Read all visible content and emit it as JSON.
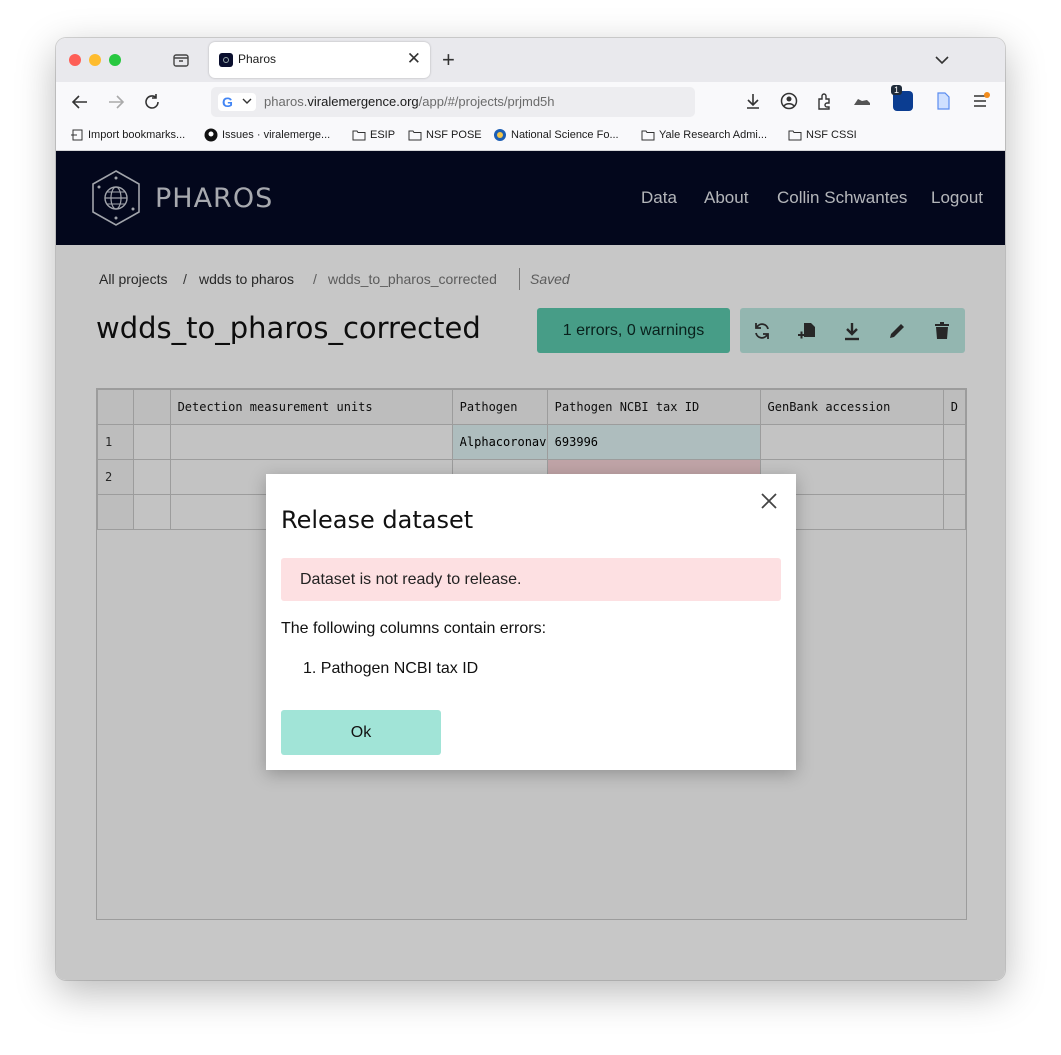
{
  "browser": {
    "tab_title": "Pharos",
    "url_prefix": "pharos.",
    "url_domain": "viralemergence.org",
    "url_path": "/app/#/projects/prjmd5h",
    "extension_badge": "1",
    "bookmarks": [
      {
        "label": "Import bookmarks...",
        "icon": "import-icon"
      },
      {
        "label": "Issues · viralemerge...",
        "icon": "github-icon"
      },
      {
        "label": "ESIP",
        "icon": "folder-icon"
      },
      {
        "label": "NSF POSE",
        "icon": "folder-icon"
      },
      {
        "label": "National Science Fo...",
        "icon": "nsf-icon"
      },
      {
        "label": "Yale Research Admi...",
        "icon": "folder-icon"
      },
      {
        "label": "NSF CSSI",
        "icon": "folder-icon"
      }
    ]
  },
  "site": {
    "logo_text": "PHAROS",
    "nav": [
      "Data",
      "About",
      "Collin Schwantes",
      "Logout"
    ]
  },
  "breadcrumb": {
    "items": [
      "All projects",
      "/",
      "wdds to pharos",
      "/",
      "wdds_to_pharos_corrected"
    ],
    "status": "Saved"
  },
  "dataset": {
    "title": "wdds_to_pharos_corrected",
    "status_button": "1 errors, 0 warnings",
    "actions": [
      "refresh-icon",
      "add-file-icon",
      "download-icon",
      "edit-icon",
      "trash-icon"
    ]
  },
  "grid": {
    "columns": [
      "",
      "",
      "Detection measurement units",
      "Pathogen",
      "Pathogen NCBI tax ID",
      "GenBank accession",
      "D"
    ],
    "rows": [
      [
        "1",
        "",
        "",
        "Alphacoronavi",
        "693996",
        "",
        ""
      ],
      [
        "2",
        "",
        "",
        "",
        "",
        "",
        ""
      ],
      [
        "",
        "",
        "",
        "",
        "",
        "",
        ""
      ]
    ]
  },
  "modal": {
    "title": "Release dataset",
    "alert": "Dataset is not ready to release.",
    "body": "The following columns contain errors:",
    "error_columns": [
      "1. Pathogen NCBI tax ID"
    ],
    "ok_label": "Ok"
  },
  "colors": {
    "header_bg": "#050a24",
    "status_green": "#5cc9ae",
    "ok_button": "#a1e4d7",
    "alert_bg": "#fde0e2"
  }
}
